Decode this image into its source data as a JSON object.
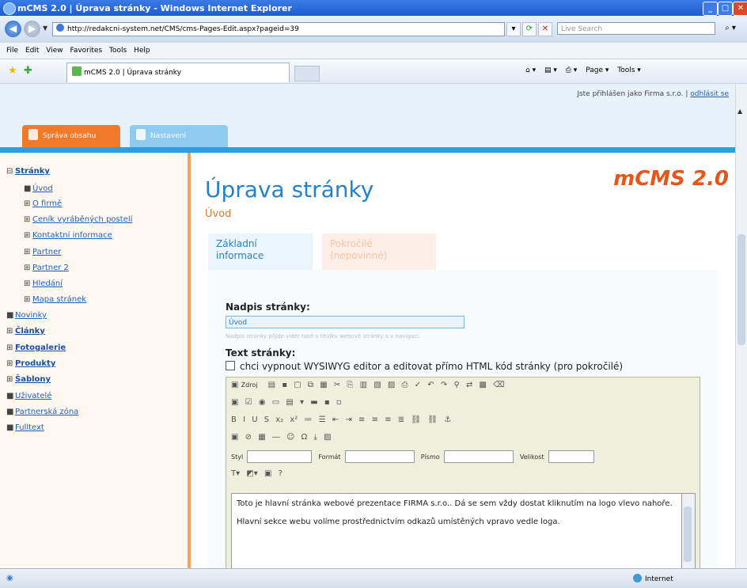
{
  "window": {
    "title": "mCMS 2.0 | Úprava stránky - Windows Internet Explorer",
    "url": "http://redakcni-system.net/CMS/cms-Pages-Edit.aspx?pageid=39",
    "search_placeholder": "Live Search",
    "tab_title": "mCMS 2.0 | Úprava stránky"
  },
  "menu": [
    "File",
    "Edit",
    "View",
    "Favorites",
    "Tools",
    "Help"
  ],
  "commandbar": {
    "page": "Page ▾",
    "tools": "Tools ▾"
  },
  "cms": {
    "user_status": "Jste přihlášen jako Firma s.r.o. | ",
    "logout_label": "odhlásit se",
    "tabs": [
      "Správa obsahu",
      "Nastavení"
    ],
    "logo": "mCMS 2.0",
    "sidebar": [
      {
        "bullet": "⊟",
        "label": "Stránky",
        "bold": true
      },
      {
        "bullet": "■",
        "label": "Úvod",
        "bold": false
      },
      {
        "bullet": "⊞",
        "label": "O firmě",
        "bold": false
      },
      {
        "bullet": "⊞",
        "label": "Ceník vyráběných postelí",
        "bold": false
      },
      {
        "bullet": "⊞",
        "label": "Kontaktní informace",
        "bold": false
      },
      {
        "bullet": "⊞",
        "label": "Partner",
        "bold": false
      },
      {
        "bullet": "⊞",
        "label": "Partner 2",
        "bold": false
      },
      {
        "bullet": "⊞",
        "label": "Hledání",
        "bold": false
      },
      {
        "bullet": "⊞",
        "label": "Mapa stránek",
        "bold": false
      },
      {
        "bullet": "■",
        "label": "Novinky",
        "bold": false
      },
      {
        "bullet": "⊞",
        "label": "Články",
        "bold": true
      },
      {
        "bullet": "⊞",
        "label": "Fotogalerie",
        "bold": true
      },
      {
        "bullet": "⊞",
        "label": "Produkty",
        "bold": true
      },
      {
        "bullet": "⊞",
        "label": "Šablony",
        "bold": true
      },
      {
        "bullet": "■",
        "label": "Uživatelé",
        "bold": false
      },
      {
        "bullet": "■",
        "label": "Partnerská zóna",
        "bold": false
      },
      {
        "bullet": "■",
        "label": "Fulltext",
        "bold": false
      }
    ],
    "page_title": "Úprava stránky",
    "page_subtitle": "Úvod",
    "content_tabs": [
      "Základní informace",
      "Pokročilé (nepovinné)"
    ],
    "form": {
      "title_label": "Nadpis stránky:",
      "title_value": "Úvod",
      "title_hint": "Nadpis stránky půjde vidět také v titulku webové stránky a v navigaci.",
      "text_label": "Text stránky:",
      "wysiwyg_checkbox": "chci vypnout WYSIWYG editor a editovat přímo HTML kód stránky (pro pokročilé)"
    },
    "editor": {
      "source_label": "Zdroj",
      "style_label": "Styl",
      "format_label": "Formát",
      "font_label": "Písmo",
      "size_label": "Velikost",
      "content": [
        "Toto je hlavní stránka webové prezentace FIRMA s.r.o.. Dá se sem vždy dostat kliknutím na logo vlevo nahoře.",
        "Hlavní sekce webu volíme prostřednictvím odkazů umístěných vpravo vedle loga."
      ]
    }
  },
  "statusbar": {
    "zone": "Internet"
  }
}
